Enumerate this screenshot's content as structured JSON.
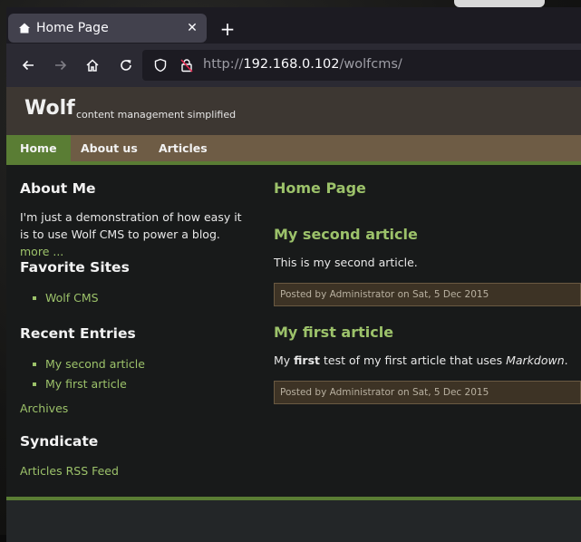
{
  "browser": {
    "tab_title": "Home Page",
    "url_scheme": "http://",
    "url_host": "192.168.0.102",
    "url_path": "/wolfcms/"
  },
  "site": {
    "name": "Wolf",
    "slogan": "content management simplified",
    "menu": [
      {
        "label": "Home",
        "active": true
      },
      {
        "label": "About us",
        "active": false
      },
      {
        "label": "Articles",
        "active": false
      }
    ]
  },
  "sidebar": {
    "about_heading": "About Me",
    "about_text": "I'm just a demonstration of how easy it is to use Wolf CMS to power a blog.",
    "about_more": "more ...",
    "favorites_heading": "Favorite Sites",
    "favorites": [
      "Wolf CMS"
    ],
    "recent_heading": "Recent Entries",
    "recent": [
      "My second article",
      "My first article"
    ],
    "archives": "Archives",
    "syndicate_heading": "Syndicate",
    "rss": "Articles RSS Feed"
  },
  "content": {
    "page_title": "Home Page",
    "articles": [
      {
        "title": "My second article",
        "body": "This is my second article.",
        "meta": "Posted by Administrator on Sat, 5 Dec 2015"
      },
      {
        "title": "My first article",
        "body_pre": "My ",
        "body_bold": "first",
        "body_mid": " test of my first article that uses ",
        "body_em": "Markdown",
        "body_post": ".",
        "meta": "Posted by Administrator on Sat, 5 Dec 2015"
      }
    ]
  },
  "colors": {
    "accent_green": "#9cc26a",
    "menu_bar": "#6e5c45",
    "header_bar": "#3d3732",
    "page_bg": "#181a1a"
  }
}
